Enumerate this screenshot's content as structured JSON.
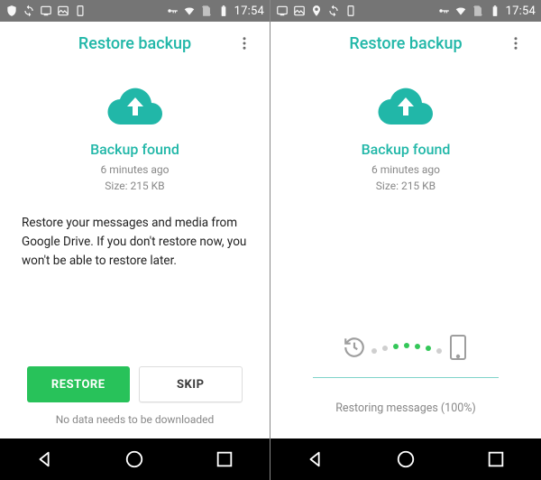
{
  "status": {
    "time": "17:54"
  },
  "left": {
    "appbar_title": "Restore backup",
    "found_title": "Backup found",
    "meta_time": "6 minutes ago",
    "meta_size": "Size: 215 KB",
    "prompt": "Restore your messages and media from Google Drive. If you don't restore now, you won't be able to restore later.",
    "btn_primary": "RESTORE",
    "btn_secondary": "SKIP",
    "footnote": "No data needs to be downloaded"
  },
  "right": {
    "appbar_title": "Restore backup",
    "found_title": "Backup found",
    "meta_time": "6 minutes ago",
    "meta_size": "Size: 215 KB",
    "progress_text": "Restoring messages (100%)"
  }
}
